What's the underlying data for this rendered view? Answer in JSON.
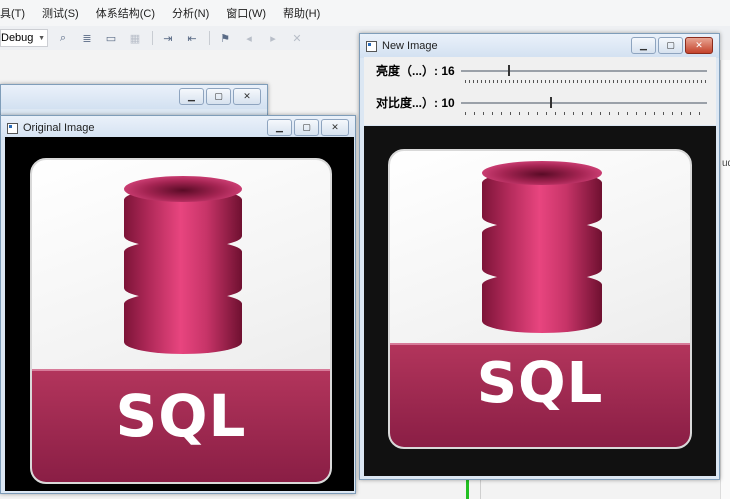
{
  "menu": {
    "items": [
      {
        "label": "具(T)"
      },
      {
        "label": "测试(S)"
      },
      {
        "label": "体系结构(C)"
      },
      {
        "label": "分析(N)"
      },
      {
        "label": "窗口(W)"
      },
      {
        "label": "帮助(H)"
      }
    ]
  },
  "toolbar": {
    "config_value": "Debug",
    "icons": [
      "find-icon",
      "bookmark-icon",
      "bookmark-prev-icon",
      "bookmark-next-icon",
      "indent-icon",
      "outdent-icon"
    ]
  },
  "ide": {
    "side_text": "ud"
  },
  "windows": {
    "original": {
      "title": "Original Image",
      "image_text": "SQL"
    },
    "new": {
      "title": "New Image",
      "image_text": "SQL",
      "trackbars": [
        {
          "label": "亮度（...）: 16",
          "value": 16
        },
        {
          "label": "对比度...）: 10",
          "value": 10
        }
      ]
    }
  },
  "colors": {
    "sql_band": "#9c2650",
    "cylinder": "#e8457f",
    "title_bar": "#dce7f3",
    "close_button": "#c4422b"
  }
}
